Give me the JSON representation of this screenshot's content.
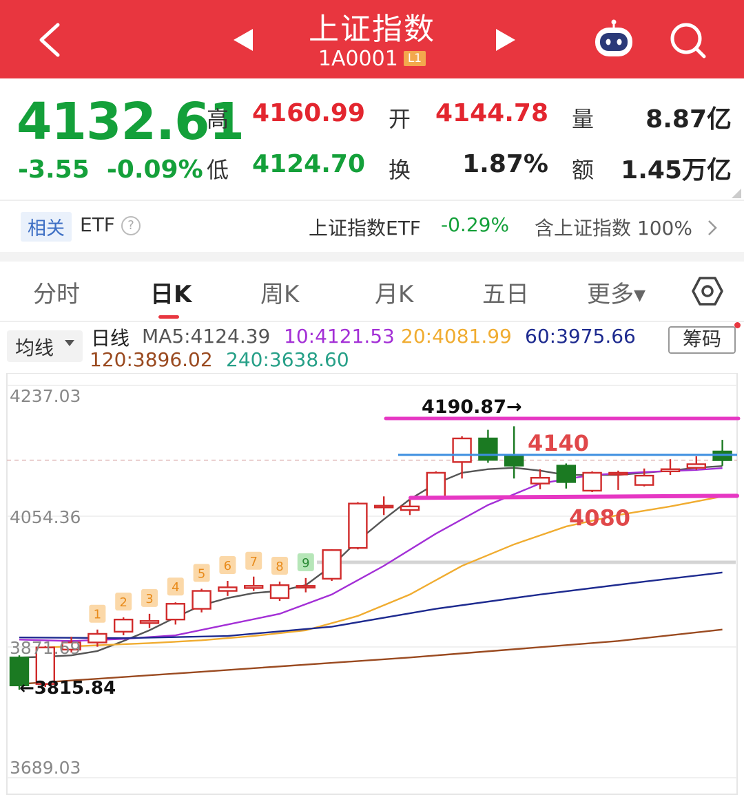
{
  "header": {
    "title": "上证指数",
    "code": "1A0001",
    "badge": "L1"
  },
  "quote": {
    "price": "4132.61",
    "change": "-3.55",
    "change_pct": "-0.09%",
    "high_label": "高",
    "high": "4160.99",
    "low_label": "低",
    "low": "4124.70",
    "open_label": "开",
    "open": "4144.78",
    "turnover_label": "换",
    "turnover": "1.87%",
    "volume_label": "量",
    "volume": "8.87亿",
    "amount_label": "额",
    "amount": "1.45万亿"
  },
  "etf": {
    "tag": "相关",
    "label": "ETF",
    "help": "?",
    "name": "上证指数ETF",
    "change": "-0.29%",
    "holding": "含上证指数 100%"
  },
  "tabs": [
    {
      "label": "分时"
    },
    {
      "label": "日K",
      "active": true
    },
    {
      "label": "周K"
    },
    {
      "label": "月K"
    },
    {
      "label": "五日"
    },
    {
      "label": "更多▾"
    }
  ],
  "ma_legend": {
    "selector": "均线",
    "period": "日线",
    "ma5": "MA5:4124.39",
    "ma10": "10:4121.53",
    "ma20": "20:4081.99",
    "ma60": "60:3975.66",
    "ma120": "120:3896.02",
    "ma240": "240:3638.60",
    "chips_button": "筹码",
    "colors": {
      "ma5": "#555555",
      "ma10": "#a32fd6",
      "ma20": "#f0ac30",
      "ma60": "#1d2a8f",
      "ma120": "#9a4a20",
      "ma240": "#27a088"
    }
  },
  "chart_data": {
    "type": "candlestick",
    "period": "daily",
    "y_axis_labels": [
      "4237.03",
      "4054.36",
      "3871.69",
      "3689.03"
    ],
    "ylim": [
      3689.03,
      4237.03
    ],
    "candles": [
      {
        "open": 3857,
        "close": 3818,
        "high": 3860,
        "low": 3812
      },
      {
        "open": 3820,
        "close": 3871,
        "high": 3873,
        "low": 3815.84
      },
      {
        "open": 3868,
        "close": 3878,
        "high": 3886,
        "low": 3864
      },
      {
        "open": 3878,
        "close": 3890,
        "high": 3896,
        "low": 3872
      },
      {
        "open": 3893,
        "close": 3910,
        "high": 3913,
        "low": 3888
      },
      {
        "open": 3905,
        "close": 3908,
        "high": 3918,
        "low": 3898
      },
      {
        "open": 3910,
        "close": 3932,
        "high": 3934,
        "low": 3903
      },
      {
        "open": 3925,
        "close": 3950,
        "high": 3953,
        "low": 3920
      },
      {
        "open": 3950,
        "close": 3955,
        "high": 3964,
        "low": 3943
      },
      {
        "open": 3954,
        "close": 3957,
        "high": 3970,
        "low": 3950
      },
      {
        "open": 3940,
        "close": 3958,
        "high": 3963,
        "low": 3936
      },
      {
        "open": 3955,
        "close": 3957,
        "high": 3968,
        "low": 3948
      },
      {
        "open": 3967,
        "close": 4007,
        "high": 4008,
        "low": 3964
      },
      {
        "open": 4010,
        "close": 4072,
        "high": 4074,
        "low": 4008
      },
      {
        "open": 4067,
        "close": 4069,
        "high": 4082,
        "low": 4056
      },
      {
        "open": 4063,
        "close": 4068,
        "high": 4079,
        "low": 4056
      },
      {
        "open": 4080,
        "close": 4115,
        "high": 4117,
        "low": 4078
      },
      {
        "open": 4130,
        "close": 4163,
        "high": 4166,
        "low": 4107
      },
      {
        "open": 4163,
        "close": 4133,
        "high": 4175,
        "low": 4129
      },
      {
        "open": 4140,
        "close": 4125,
        "high": 4180,
        "low": 4107
      },
      {
        "open": 4100,
        "close": 4108,
        "high": 4120,
        "low": 4092
      },
      {
        "open": 4125,
        "close": 4102,
        "high": 4128,
        "low": 4093
      },
      {
        "open": 4090,
        "close": 4115,
        "high": 4117,
        "low": 4088
      },
      {
        "open": 4115,
        "close": 4115,
        "high": 4118,
        "low": 4091
      },
      {
        "open": 4098,
        "close": 4111,
        "high": 4121,
        "low": 4096
      },
      {
        "open": 4117,
        "close": 4120,
        "high": 4134,
        "low": 4112
      },
      {
        "open": 4122,
        "close": 4127,
        "high": 4138,
        "low": 4119
      },
      {
        "open": 4144.78,
        "close": 4132.61,
        "high": 4160.99,
        "low": 4124.7
      }
    ],
    "ma_lines": {
      "MA5": [
        [
          1,
          3857
        ],
        [
          2,
          3858
        ],
        [
          3,
          3860
        ],
        [
          4,
          3866
        ],
        [
          5,
          3880
        ],
        [
          6,
          3895
        ],
        [
          7,
          3913
        ],
        [
          8,
          3930
        ],
        [
          9,
          3940
        ],
        [
          10,
          3947
        ],
        [
          11,
          3950
        ],
        [
          12,
          3958
        ],
        [
          13,
          3985
        ],
        [
          14,
          4020
        ],
        [
          15,
          4050
        ],
        [
          16,
          4078
        ],
        [
          17,
          4100
        ],
        [
          18,
          4115
        ],
        [
          19,
          4120
        ],
        [
          20,
          4122
        ],
        [
          21,
          4118
        ],
        [
          22,
          4112
        ],
        [
          23,
          4112
        ],
        [
          24,
          4112
        ],
        [
          25,
          4115
        ],
        [
          26,
          4118
        ],
        [
          27,
          4122
        ],
        [
          28,
          4124.39
        ]
      ],
      "MA10": [
        [
          1,
          3882
        ],
        [
          3,
          3880
        ],
        [
          5,
          3883
        ],
        [
          7,
          3888
        ],
        [
          9,
          3903
        ],
        [
          11,
          3918
        ],
        [
          13,
          3945
        ],
        [
          15,
          3985
        ],
        [
          17,
          4030
        ],
        [
          19,
          4070
        ],
        [
          21,
          4100
        ],
        [
          23,
          4112
        ],
        [
          25,
          4116
        ],
        [
          27,
          4119
        ],
        [
          28,
          4121.53
        ]
      ],
      "MA20": [
        [
          2,
          3871
        ],
        [
          4,
          3874
        ],
        [
          6,
          3877
        ],
        [
          8,
          3881
        ],
        [
          10,
          3887
        ],
        [
          12,
          3895
        ],
        [
          14,
          3915
        ],
        [
          16,
          3945
        ],
        [
          18,
          3985
        ],
        [
          20,
          4015
        ],
        [
          22,
          4040
        ],
        [
          24,
          4056
        ],
        [
          26,
          4068
        ],
        [
          28,
          4081.99
        ]
      ],
      "MA60": [
        [
          1,
          3885
        ],
        [
          5,
          3884
        ],
        [
          9,
          3887
        ],
        [
          13,
          3900
        ],
        [
          17,
          3925
        ],
        [
          21,
          3945
        ],
        [
          25,
          3963
        ],
        [
          28,
          3975.66
        ]
      ],
      "MA120": [
        [
          1,
          3820
        ],
        [
          8,
          3837
        ],
        [
          16,
          3857
        ],
        [
          24,
          3880
        ],
        [
          28,
          3896.02
        ]
      ]
    },
    "annotations": {
      "max_label": "4190.87→",
      "min_label": "←3815.84",
      "line_4190": 4190.87,
      "resistance_label": "4140",
      "resistance_value": 4140,
      "support_label": "4080",
      "support_value": 4080,
      "grey_level": 3990,
      "sequence_markers": [
        "1",
        "2",
        "3",
        "4",
        "5",
        "6",
        "7",
        "8",
        "9"
      ],
      "sequence_candles": [
        4,
        5,
        6,
        7,
        8,
        9,
        10,
        11,
        12
      ],
      "up_color": "#d02a2a",
      "down_color": "#1b7a22",
      "highlight_color": "#e637c3",
      "resistance_color": "#3d8fe0"
    }
  }
}
